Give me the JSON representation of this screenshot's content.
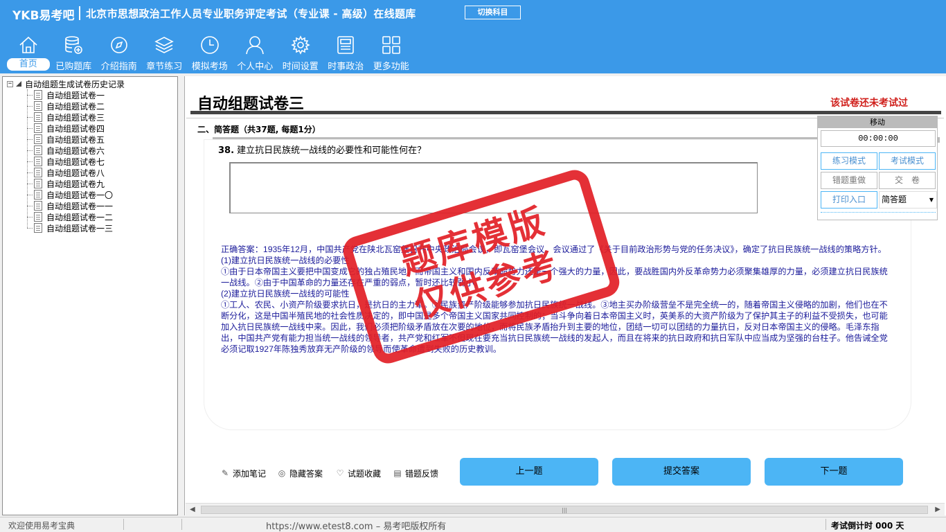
{
  "header": {
    "brand": "YKB易考吧",
    "app_title": "北京市思想政治工作人员专业职务评定考试（专业课 - 高级）在线题库",
    "switch_label": "切换科目"
  },
  "nav": [
    {
      "label": "首页",
      "icon": "home-icon"
    },
    {
      "label": "已购题库",
      "icon": "database-icon"
    },
    {
      "label": "介绍指南",
      "icon": "compass-icon"
    },
    {
      "label": "章节练习",
      "icon": "layers-icon"
    },
    {
      "label": "模拟考场",
      "icon": "clock-icon"
    },
    {
      "label": "个人中心",
      "icon": "user-icon"
    },
    {
      "label": "时间设置",
      "icon": "gear-icon"
    },
    {
      "label": "时事政治",
      "icon": "news-icon"
    },
    {
      "label": "更多功能",
      "icon": "grid-icon"
    }
  ],
  "tree": {
    "root": "自动组题生成试卷历史记录",
    "items": [
      "自动组题试卷一",
      "自动组题试卷二",
      "自动组题试卷三",
      "自动组题试卷四",
      "自动组题试卷五",
      "自动组题试卷六",
      "自动组题试卷七",
      "自动组题试卷八",
      "自动组题试卷九",
      "自动组题试卷一〇",
      "自动组题试卷一一",
      "自动组题试卷一二",
      "自动组题试卷一三"
    ]
  },
  "paper": {
    "title": "自动组题试卷三",
    "status": "该试卷还未考试过",
    "section": "二、简答题（共37题, 每题1分）"
  },
  "question": {
    "number": "38.",
    "text": "建立抗日民族统一战线的必要性和可能性何在？",
    "explanation": [
      "正确答案：1935年12月，中国共产党在陕北瓦窑堡召开中央政治局会议，即瓦窑堡会议。会议通过了《关于目前政治形势与党的任务决议》，确定了抗日民族统一战线的策略方针。",
      "(1)建立抗日民族统一战线的必要性",
      "①由于日本帝国主义要把中国变成它的独占殖民地，而帝国主义和国内反革命势力还是一个强大的力量，因此，要战胜国内外反革命势力必须聚集雄厚的力量，必须建立抗日民族统一战线。②由于中国革命的力量还存在严重的弱点，暂时还比较弱小。",
      "(2)建立抗日民族统一战线的可能性",
      "①工人、农民、小资产阶级要求抗日，是抗日的主力军。②民族资产阶级能够参加抗日民族统一战线。③地主买办阶级营垒不是完全统一的，随着帝国主义侵略的加剧，他们也在不断分化，这是中国半殖民地的社会性质决定的，即中国是多个帝国主义国家共同控制的；当斗争向着日本帝国主义时，英美系的大资产阶级为了保护其主子的利益不受损失，也可能加入抗日民族统一战线中来。因此，我们必须把阶级矛盾放在次要的地位，而将民族矛盾抬升到主要的地位，团结一切可以团结的力量抗日，反对日本帝国主义的侵略。毛泽东指出，中国共产党有能力担当统一战线的领导者，共产党和红军不但现在要充当抗日民族统一战线的发起人，而且在将来的抗日政府和抗日军队中应当成为坚强的台柱子。他告诫全党必须记取1927年陈独秀放弃无产阶级的领导而使革命遭到失败的历史教训。"
    ]
  },
  "tools": {
    "note": "添加笔记",
    "hide_answer": "隐藏答案",
    "favorite": "试题收藏",
    "feedback": "错题反馈"
  },
  "buttons": {
    "prev": "上一题",
    "submit": "提交答案",
    "next": "下一题"
  },
  "float_panel": {
    "move": "移动",
    "timer": "00:00:00",
    "practice_mode": "练习模式",
    "exam_mode": "考试模式",
    "redo_wrong": "错题重做",
    "hand_in": "交　卷",
    "print": "打印入口",
    "type_select": "简答题"
  },
  "watermark": {
    "line1": "题库模版",
    "line2": "仅供参考"
  },
  "status": {
    "welcome": "欢迎使用易考宝典",
    "copyright": "https://www.etest8.com – 易考吧版权所有",
    "countdown": "考试倒计时 000 天"
  }
}
